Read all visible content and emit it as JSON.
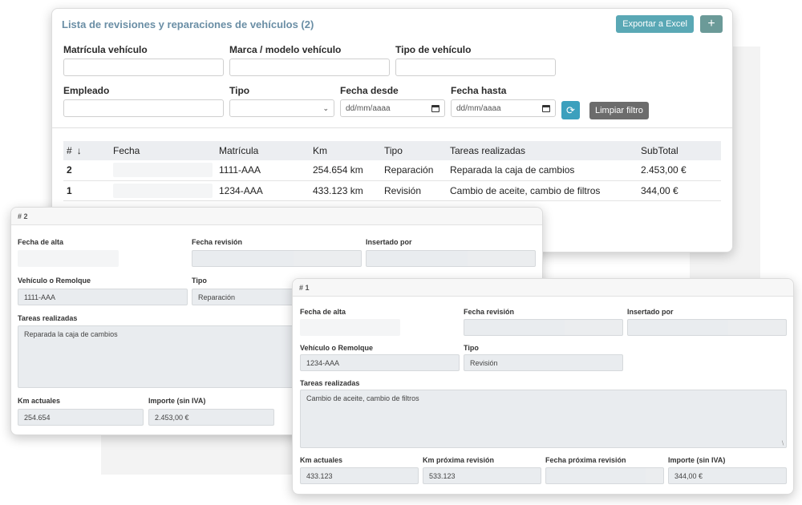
{
  "list": {
    "title": "Lista de revisiones y reparaciones de vehículos (2)",
    "export_label": "Exportar a Excel",
    "add_label": "+",
    "filters": {
      "matricula_label": "Matrícula vehículo",
      "marca_label": "Marca / modelo vehículo",
      "tipo_vehiculo_label": "Tipo de vehículo",
      "empleado_label": "Empleado",
      "tipo_label": "Tipo",
      "desde_label": "Fecha desde",
      "hasta_label": "Fecha hasta",
      "desde_placeholder": "dd/mm/aaaa",
      "hasta_placeholder": "dd/mm/aaaa",
      "refresh_icon": "⟳",
      "clear_label": "Limpiar filtro"
    },
    "columns": [
      "#",
      "Fecha",
      "Matrícula",
      "Km",
      "Tipo",
      "Tareas realizadas",
      "SubTotal"
    ],
    "rows": [
      {
        "num": "2",
        "matricula": "1111-AAA",
        "km": "254.654 km",
        "tipo": "Reparación",
        "tareas": "Reparada la caja de cambios",
        "subtotal": "2.453,00 €"
      },
      {
        "num": "1",
        "matricula": "1234-AAA",
        "km": "433.123 km",
        "tipo": "Revisión",
        "tareas": "Cambio de aceite, cambio de filtros",
        "subtotal": "344,00 €"
      }
    ]
  },
  "card2": {
    "header": "# 2",
    "fecha_alta_label": "Fecha de alta",
    "fecha_revision_label": "Fecha revisión",
    "insertado_label": "Insertado por",
    "vehiculo_label": "Vehículo o Remolque",
    "vehiculo_value": "1111-AAA",
    "tipo_label": "Tipo",
    "tipo_value": "Reparación",
    "tareas_label": "Tareas realizadas",
    "tareas_value": "Reparada la caja de cambios",
    "km_label": "Km actuales",
    "km_value": "254.654",
    "importe_label": "Importe (sin IVA)",
    "importe_value": "2.453,00 €"
  },
  "card1": {
    "header": "# 1",
    "fecha_alta_label": "Fecha de alta",
    "fecha_revision_label": "Fecha revisión",
    "insertado_label": "Insertado por",
    "vehiculo_label": "Vehículo o Remolque",
    "vehiculo_value": "1234-AAA",
    "tipo_label": "Tipo",
    "tipo_value": "Revisión",
    "tareas_label": "Tareas realizadas",
    "tareas_value": "Cambio de aceite, cambio de filtros",
    "km_label": "Km actuales",
    "km_value": "433.123",
    "km_prox_label": "Km próxima revisión",
    "km_prox_value": "533.123",
    "fecha_prox_label": "Fecha próxima revisión",
    "importe_label": "Importe (sin IVA)",
    "importe_value": "344,00 €"
  },
  "colors": {
    "title": "#6a8ea5",
    "btn_info": "#5aa8b5",
    "btn_add": "#6b9a98",
    "btn_refresh": "#3ca0bd",
    "btn_clear": "#6c6c6c"
  },
  "icons": {
    "sort": "sort-arrow-down-icon",
    "refresh": "refresh-icon",
    "calendar": "calendar-icon",
    "select": "chevron-down-icon"
  }
}
